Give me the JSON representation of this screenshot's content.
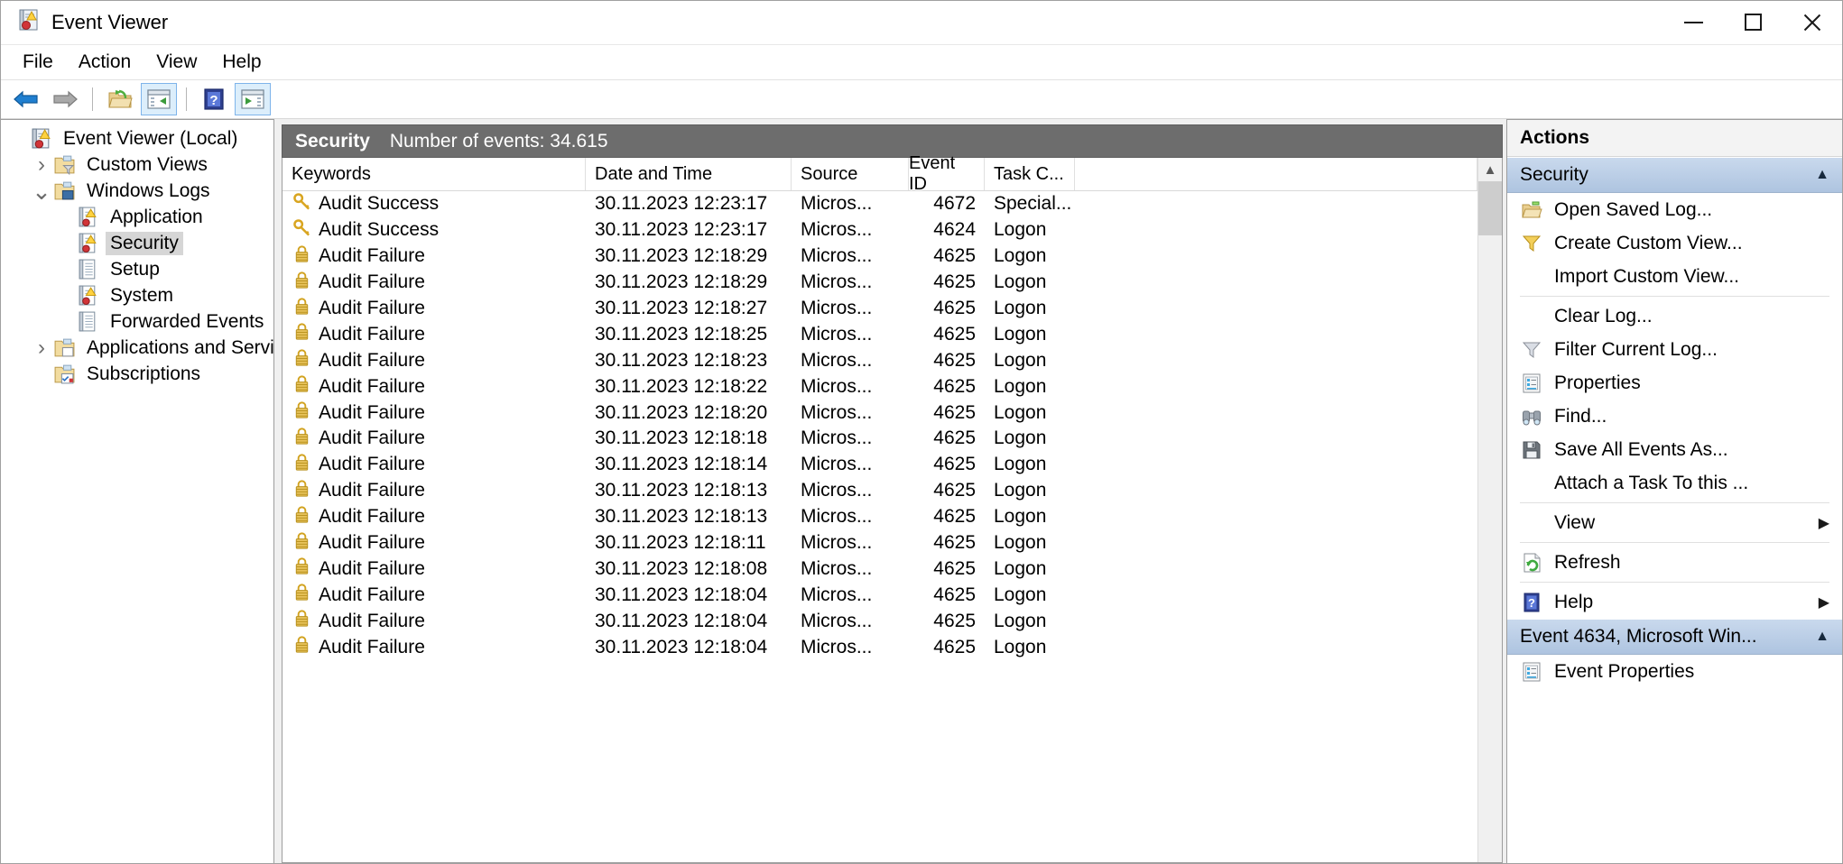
{
  "window": {
    "title": "Event Viewer",
    "app_icon": "event-viewer-icon",
    "minimize_label": "—",
    "maximize_label": "□",
    "close_label": "✕"
  },
  "menubar": {
    "items": [
      {
        "label": "File"
      },
      {
        "label": "Action"
      },
      {
        "label": "View"
      },
      {
        "label": "Help"
      }
    ]
  },
  "toolbar": {
    "buttons": [
      {
        "name": "back-button",
        "icon": "back-arrow-icon",
        "pressed": false
      },
      {
        "name": "forward-button",
        "icon": "forward-arrow-icon",
        "pressed": false
      },
      {
        "name": "open-folder-button",
        "icon": "open-folder-icon",
        "pressed": false
      },
      {
        "name": "show-console-tree-button",
        "icon": "console-tree-icon",
        "pressed": true
      },
      {
        "name": "help-button",
        "icon": "help-question-icon",
        "pressed": false
      },
      {
        "name": "show-action-pane-button",
        "icon": "action-pane-icon",
        "pressed": true
      }
    ]
  },
  "tree": {
    "nodes": [
      {
        "label": "Event Viewer (Local)",
        "indent": 0,
        "twisty": "",
        "icon": "event-viewer-icon",
        "selected": false
      },
      {
        "label": "Custom Views",
        "indent": 1,
        "twisty": "›",
        "icon": "folder-filter-icon",
        "selected": false
      },
      {
        "label": "Windows Logs",
        "indent": 1,
        "twisty": "⌄",
        "icon": "folder-windows-icon",
        "selected": false
      },
      {
        "label": "Application",
        "indent": 2,
        "twisty": "",
        "icon": "log-warning-icon",
        "selected": false
      },
      {
        "label": "Security",
        "indent": 2,
        "twisty": "",
        "icon": "log-warning-icon",
        "selected": true
      },
      {
        "label": "Setup",
        "indent": 2,
        "twisty": "",
        "icon": "log-plain-icon",
        "selected": false
      },
      {
        "label": "System",
        "indent": 2,
        "twisty": "",
        "icon": "log-warning-icon",
        "selected": false
      },
      {
        "label": "Forwarded Events",
        "indent": 2,
        "twisty": "",
        "icon": "log-plain-icon",
        "selected": false
      },
      {
        "label": "Applications and Services Lo",
        "indent": 1,
        "twisty": "›",
        "icon": "folder-apps-icon",
        "selected": false
      },
      {
        "label": "Subscriptions",
        "indent": 1,
        "twisty": "",
        "icon": "folder-subscriptions-icon",
        "selected": false
      }
    ]
  },
  "log": {
    "name": "Security",
    "count_label": "Number of events: 34.615",
    "columns": [
      {
        "key": "keywords",
        "label": "Keywords"
      },
      {
        "key": "datetime",
        "label": "Date and Time"
      },
      {
        "key": "source",
        "label": "Source"
      },
      {
        "key": "eventid",
        "label": "Event ID"
      },
      {
        "key": "task",
        "label": "Task C..."
      }
    ],
    "rows": [
      {
        "icon": "key-icon",
        "keywords": "Audit Success",
        "datetime": "30.11.2023 12:23:17",
        "source": "Micros...",
        "eventid": "4672",
        "task": "Special..."
      },
      {
        "icon": "key-icon",
        "keywords": "Audit Success",
        "datetime": "30.11.2023 12:23:17",
        "source": "Micros...",
        "eventid": "4624",
        "task": "Logon"
      },
      {
        "icon": "lock-icon",
        "keywords": "Audit Failure",
        "datetime": "30.11.2023 12:18:29",
        "source": "Micros...",
        "eventid": "4625",
        "task": "Logon"
      },
      {
        "icon": "lock-icon",
        "keywords": "Audit Failure",
        "datetime": "30.11.2023 12:18:29",
        "source": "Micros...",
        "eventid": "4625",
        "task": "Logon"
      },
      {
        "icon": "lock-icon",
        "keywords": "Audit Failure",
        "datetime": "30.11.2023 12:18:27",
        "source": "Micros...",
        "eventid": "4625",
        "task": "Logon"
      },
      {
        "icon": "lock-icon",
        "keywords": "Audit Failure",
        "datetime": "30.11.2023 12:18:25",
        "source": "Micros...",
        "eventid": "4625",
        "task": "Logon"
      },
      {
        "icon": "lock-icon",
        "keywords": "Audit Failure",
        "datetime": "30.11.2023 12:18:23",
        "source": "Micros...",
        "eventid": "4625",
        "task": "Logon"
      },
      {
        "icon": "lock-icon",
        "keywords": "Audit Failure",
        "datetime": "30.11.2023 12:18:22",
        "source": "Micros...",
        "eventid": "4625",
        "task": "Logon"
      },
      {
        "icon": "lock-icon",
        "keywords": "Audit Failure",
        "datetime": "30.11.2023 12:18:20",
        "source": "Micros...",
        "eventid": "4625",
        "task": "Logon"
      },
      {
        "icon": "lock-icon",
        "keywords": "Audit Failure",
        "datetime": "30.11.2023 12:18:18",
        "source": "Micros...",
        "eventid": "4625",
        "task": "Logon"
      },
      {
        "icon": "lock-icon",
        "keywords": "Audit Failure",
        "datetime": "30.11.2023 12:18:14",
        "source": "Micros...",
        "eventid": "4625",
        "task": "Logon"
      },
      {
        "icon": "lock-icon",
        "keywords": "Audit Failure",
        "datetime": "30.11.2023 12:18:13",
        "source": "Micros...",
        "eventid": "4625",
        "task": "Logon"
      },
      {
        "icon": "lock-icon",
        "keywords": "Audit Failure",
        "datetime": "30.11.2023 12:18:13",
        "source": "Micros...",
        "eventid": "4625",
        "task": "Logon"
      },
      {
        "icon": "lock-icon",
        "keywords": "Audit Failure",
        "datetime": "30.11.2023 12:18:11",
        "source": "Micros...",
        "eventid": "4625",
        "task": "Logon"
      },
      {
        "icon": "lock-icon",
        "keywords": "Audit Failure",
        "datetime": "30.11.2023 12:18:08",
        "source": "Micros...",
        "eventid": "4625",
        "task": "Logon"
      },
      {
        "icon": "lock-icon",
        "keywords": "Audit Failure",
        "datetime": "30.11.2023 12:18:04",
        "source": "Micros...",
        "eventid": "4625",
        "task": "Logon"
      },
      {
        "icon": "lock-icon",
        "keywords": "Audit Failure",
        "datetime": "30.11.2023 12:18:04",
        "source": "Micros...",
        "eventid": "4625",
        "task": "Logon"
      },
      {
        "icon": "lock-icon",
        "keywords": "Audit Failure",
        "datetime": "30.11.2023 12:18:04",
        "source": "Micros...",
        "eventid": "4625",
        "task": "Logon"
      }
    ]
  },
  "actions": {
    "title": "Actions",
    "sections": [
      {
        "header": "Security",
        "collapse_glyph": "▲",
        "items": [
          {
            "label": "Open Saved Log...",
            "icon": "open-folder-icon",
            "arrow": "",
            "sep_after": false
          },
          {
            "label": "Create Custom View...",
            "icon": "funnel-yellow-icon",
            "arrow": "",
            "sep_after": false
          },
          {
            "label": "Import Custom View...",
            "icon": "",
            "arrow": "",
            "sep_after": true
          },
          {
            "label": "Clear Log...",
            "icon": "",
            "arrow": "",
            "sep_after": false
          },
          {
            "label": "Filter Current Log...",
            "icon": "funnel-icon",
            "arrow": "",
            "sep_after": false
          },
          {
            "label": "Properties",
            "icon": "properties-icon",
            "arrow": "",
            "sep_after": false
          },
          {
            "label": "Find...",
            "icon": "binoculars-icon",
            "arrow": "",
            "sep_after": false
          },
          {
            "label": "Save All Events As...",
            "icon": "floppy-icon",
            "arrow": "",
            "sep_after": false
          },
          {
            "label": "Attach a Task To this ...",
            "icon": "",
            "arrow": "",
            "sep_after": true
          },
          {
            "label": "View",
            "icon": "",
            "arrow": "▶",
            "sep_after": true
          },
          {
            "label": "Refresh",
            "icon": "refresh-icon",
            "arrow": "",
            "sep_after": true
          },
          {
            "label": "Help",
            "icon": "help-question-icon",
            "arrow": "▶",
            "sep_after": false
          }
        ]
      },
      {
        "header": "Event 4634, Microsoft Win...",
        "collapse_glyph": "▲",
        "items": [
          {
            "label": "Event Properties",
            "icon": "properties-icon",
            "arrow": "",
            "sep_after": false
          }
        ]
      }
    ]
  }
}
